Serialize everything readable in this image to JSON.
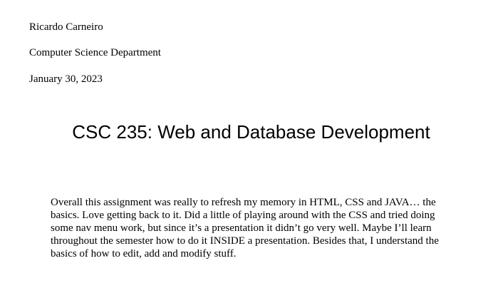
{
  "header": {
    "author": "Ricardo Carneiro",
    "department": "Computer Science Department",
    "date": "January 30, 2023"
  },
  "title": "CSC 235: Web and Database Development",
  "body": "Overall this assignment was really to refresh my memory in HTML, CSS and JAVA… the basics. Love getting back to it. Did a little of playing around with the CSS and tried doing some nav menu work, but since it’s a presentation it didn’t go very well. Maybe I’ll learn throughout the semester how to do it INSIDE a presentation. Besides that, I understand the basics of how to edit, add and modify stuff."
}
